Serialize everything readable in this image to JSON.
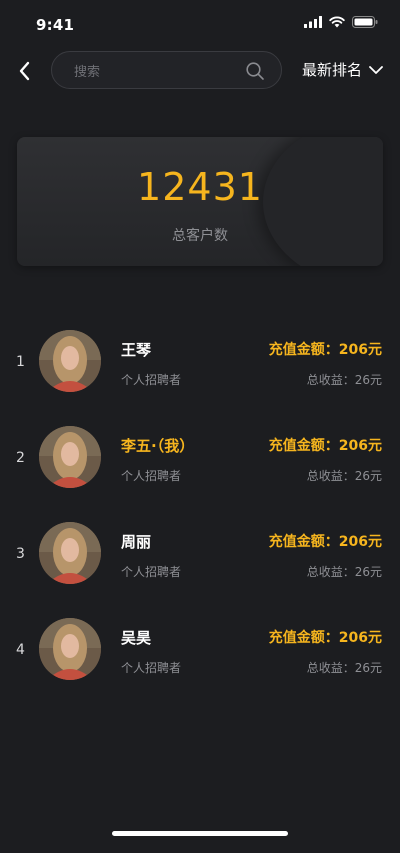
{
  "status_bar": {
    "time": "9:41"
  },
  "search": {
    "placeholder": "搜索",
    "value": ""
  },
  "sort": {
    "label": "最新排名"
  },
  "summary": {
    "total": "12431",
    "label": "总客户数"
  },
  "customers": [
    {
      "rank": "1",
      "name": "王琴",
      "role": "个人招聘者",
      "recharge": "充值金额：206元",
      "income": "总收益：26元",
      "is_me": false
    },
    {
      "rank": "2",
      "name": "李五·（我）",
      "role": "个人招聘者",
      "recharge": "充值金额：206元",
      "income": "总收益：26元",
      "is_me": true
    },
    {
      "rank": "3",
      "name": "周丽",
      "role": "个人招聘者",
      "recharge": "充值金额：206元",
      "income": "总收益：26元",
      "is_me": false
    },
    {
      "rank": "4",
      "name": "吴昊",
      "role": "个人招聘者",
      "recharge": "充值金额：206元",
      "income": "总收益：26元",
      "is_me": false
    }
  ],
  "colors": {
    "accent": "#f6b51e",
    "background": "#1c1d20",
    "card": "#2b2c2f",
    "muted": "#8e8f94"
  },
  "icons": {
    "back": "chevron-left-icon",
    "search": "search-icon",
    "sort": "chevron-down-icon"
  }
}
